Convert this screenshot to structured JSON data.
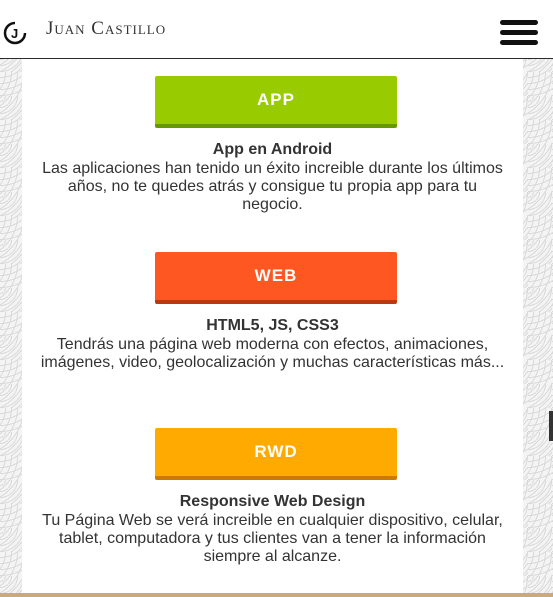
{
  "header": {
    "brand": "Juan Castillo",
    "logo_letter": "J",
    "menu_icon": "hamburger-menu-icon"
  },
  "services": [
    {
      "button_label": "APP",
      "button_color": "#99cc00",
      "button_shadow": "#669900",
      "title": "App en Android",
      "description": "Las aplicaciones han tenido un éxito increible durante los últimos años, no te quedes atrás y consigue tu propia app para tu negocio."
    },
    {
      "button_label": "WEB",
      "button_color": "#ff5722",
      "button_shadow": "#b83a12",
      "title": "HTML5, JS, CSS3",
      "description": "Tendrás una página web moderna con efectos, animaciones, imágenes, video, geolocalización y muchas características más..."
    },
    {
      "button_label": "RWD",
      "button_color": "#ffaa00",
      "button_shadow": "#cc7a00",
      "title": "Responsive Web Design",
      "description": "Tu Página Web se verá increible en cualquier dispositivo, celular, tablet, computadora y tus clientes van a tener la información siempre al alcanze."
    }
  ]
}
